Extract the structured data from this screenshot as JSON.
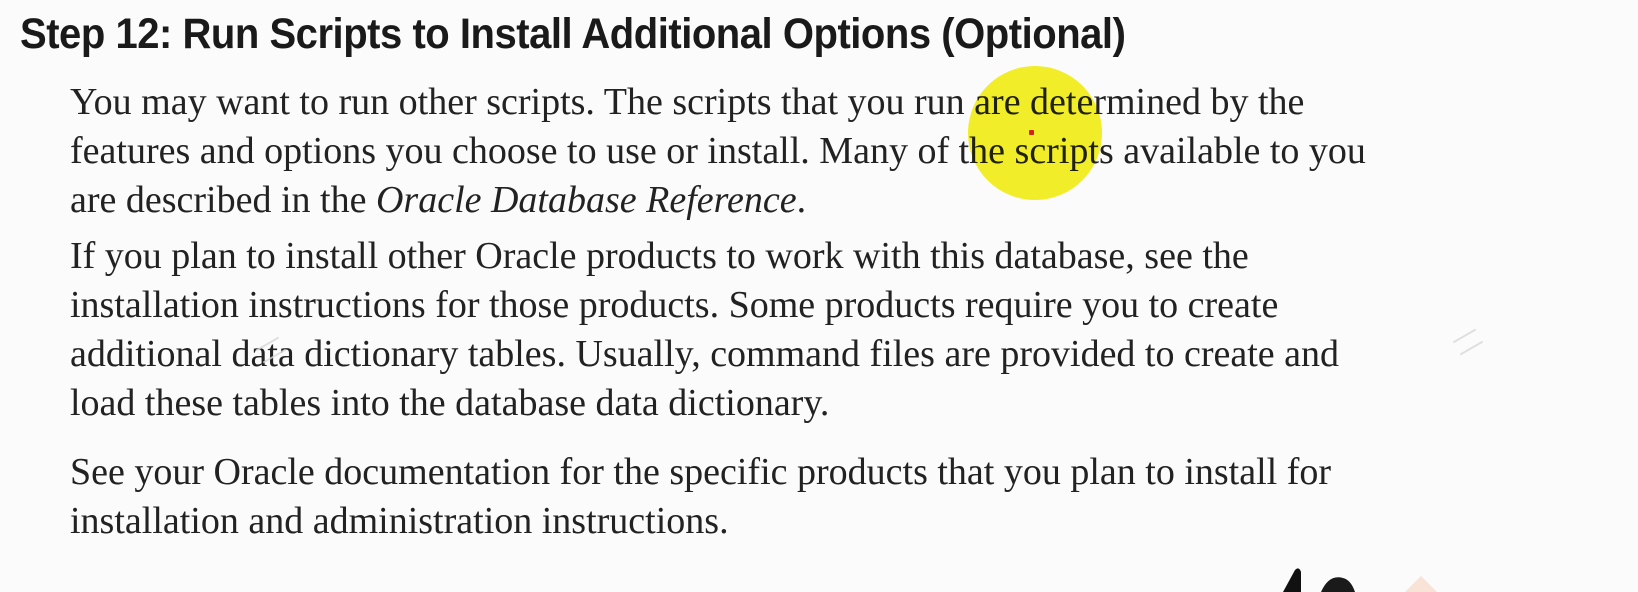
{
  "heading": "Step 12: Run Scripts to Install Additional Options (Optional)",
  "paragraph1": {
    "line1": "You may want to run other scripts. The scripts that you run are determined by the",
    "line2": "features and options you choose to use or install. Many of the scripts available to you",
    "line3_prefix": "are described in the ",
    "line3_reference": "Oracle Database Reference",
    "line3_suffix": "."
  },
  "paragraph2": {
    "line1": "If you plan to install other Oracle products to work with this database, see the",
    "line2": "installation instructions for those products. Some products require you to create",
    "line3": "additional data dictionary tables. Usually, command files are provided to create and",
    "line4": "load these tables into the database data dictionary."
  },
  "paragraph3": {
    "line1": "See your Oracle documentation for the specific products that you plan to install for",
    "line2": "installation and administration instructions."
  },
  "colors": {
    "highlight": "#f5f015",
    "pointer": "#d62020",
    "text": "#222222"
  }
}
